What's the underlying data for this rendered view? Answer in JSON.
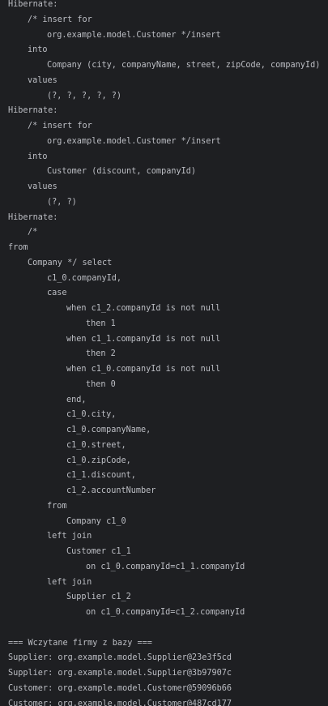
{
  "console": {
    "lines": [
      {
        "indent": 0,
        "text": "Hibernate:"
      },
      {
        "indent": 1,
        "text": "/* insert for"
      },
      {
        "indent": 2,
        "text": "org.example.model.Customer */insert"
      },
      {
        "indent": 1,
        "text": "into"
      },
      {
        "indent": 2,
        "text": "Company (city, companyName, street, zipCode, companyId)"
      },
      {
        "indent": 1,
        "text": "values"
      },
      {
        "indent": 2,
        "text": "(?, ?, ?, ?, ?)"
      },
      {
        "indent": 0,
        "text": "Hibernate:"
      },
      {
        "indent": 1,
        "text": "/* insert for"
      },
      {
        "indent": 2,
        "text": "org.example.model.Customer */insert"
      },
      {
        "indent": 1,
        "text": "into"
      },
      {
        "indent": 2,
        "text": "Customer (discount, companyId)"
      },
      {
        "indent": 1,
        "text": "values"
      },
      {
        "indent": 2,
        "text": "(?, ?)"
      },
      {
        "indent": 0,
        "text": "Hibernate:"
      },
      {
        "indent": 1,
        "text": "/*"
      },
      {
        "indent": 0,
        "text": "from"
      },
      {
        "indent": 1,
        "text": "Company */ select"
      },
      {
        "indent": 2,
        "text": "c1_0.companyId,"
      },
      {
        "indent": 2,
        "text": "case"
      },
      {
        "indent": 3,
        "text": "when c1_2.companyId is not null"
      },
      {
        "indent": 4,
        "text": "then 1"
      },
      {
        "indent": 3,
        "text": "when c1_1.companyId is not null"
      },
      {
        "indent": 4,
        "text": "then 2"
      },
      {
        "indent": 3,
        "text": "when c1_0.companyId is not null"
      },
      {
        "indent": 4,
        "text": "then 0"
      },
      {
        "indent": 3,
        "text": "end,"
      },
      {
        "indent": 3,
        "text": "c1_0.city,"
      },
      {
        "indent": 3,
        "text": "c1_0.companyName,"
      },
      {
        "indent": 3,
        "text": "c1_0.street,"
      },
      {
        "indent": 3,
        "text": "c1_0.zipCode,"
      },
      {
        "indent": 3,
        "text": "c1_1.discount,"
      },
      {
        "indent": 3,
        "text": "c1_2.accountNumber"
      },
      {
        "indent": 2,
        "text": "from"
      },
      {
        "indent": 3,
        "text": "Company c1_0"
      },
      {
        "indent": 2,
        "text": "left join"
      },
      {
        "indent": 3,
        "text": "Customer c1_1"
      },
      {
        "indent": 4,
        "text": "on c1_0.companyId=c1_1.companyId"
      },
      {
        "indent": 2,
        "text": "left join"
      },
      {
        "indent": 3,
        "text": "Supplier c1_2"
      },
      {
        "indent": 4,
        "text": "on c1_0.companyId=c1_2.companyId"
      },
      {
        "indent": 0,
        "text": ""
      },
      {
        "indent": 0,
        "text": "=== Wczytane firmy z bazy ==="
      },
      {
        "indent": 0,
        "text": "Supplier: org.example.model.Supplier@23e3f5cd"
      },
      {
        "indent": 0,
        "text": "Supplier: org.example.model.Supplier@3b97907c"
      },
      {
        "indent": 0,
        "text": "Customer: org.example.model.Customer@59096b66"
      },
      {
        "indent": 0,
        "text": "Customer: org.example.model.Customer@487cd177"
      }
    ]
  }
}
